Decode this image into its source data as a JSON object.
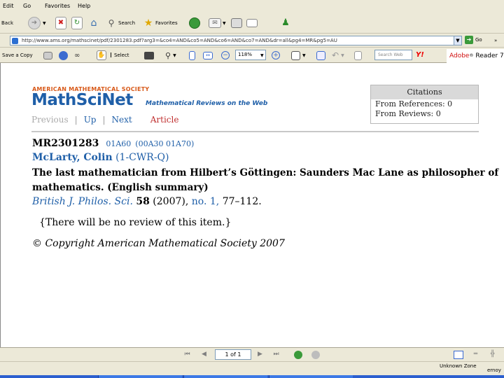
{
  "menubar": {
    "items": [
      "Edit",
      "Go",
      "Favorites",
      "Help"
    ]
  },
  "toolbar": {
    "back_label": "Back",
    "search_label": "Search",
    "favorites_label": "Favorites"
  },
  "address": {
    "url": "http://www.ams.org/mathscinet/pdf/2301283.pdf?arg3=&co4=AND&co5=AND&co6=AND&co7=AND&dr=all&pg4=MR&pg5=AU",
    "go_label": "Go"
  },
  "reader_toolbar": {
    "save_label": "Save a Copy",
    "select_label": "Select",
    "zoom_value": "118%",
    "search_placeholder": "Search Web",
    "yahoo": "Y!",
    "adobe_label": "Adobe",
    "reader_label": "Reader 7"
  },
  "mathscinet": {
    "ams_header": "AMERICAN MATHEMATICAL SOCIETY",
    "logo": "MathSciNet",
    "tagline": "Mathematical Reviews on the Web",
    "nav": {
      "previous": "Previous",
      "up": "Up",
      "next": "Next",
      "article": "Article"
    },
    "citations": {
      "header": "Citations",
      "from_references": "From References: 0",
      "from_reviews": "From Reviews: 0"
    },
    "record": {
      "mr_number": "MR2301283",
      "class_primary": "01A60",
      "class_secondary": "(00A30 01A70)",
      "author_name": "McLarty, Colin",
      "author_inst": "(1-CWR-Q)",
      "title_line1": "The last mathematician from Hilbert’s Göttingen: Saunders Mac Lane as philosopher of",
      "title_line2": "mathematics. (English summary)",
      "journal": "British J. Philos. Sci.",
      "volume": "58",
      "year": "(2007),",
      "issue": "no. 1,",
      "pages": "77–112.",
      "review_note": "{There will be no review of this item.}",
      "copyright": "© Copyright American Mathematical Society 2007"
    }
  },
  "pdf_nav": {
    "page_indicator": "1 of 1"
  },
  "status": {
    "zone": "Unknown Zone",
    "zone_edge": "ernoy"
  }
}
